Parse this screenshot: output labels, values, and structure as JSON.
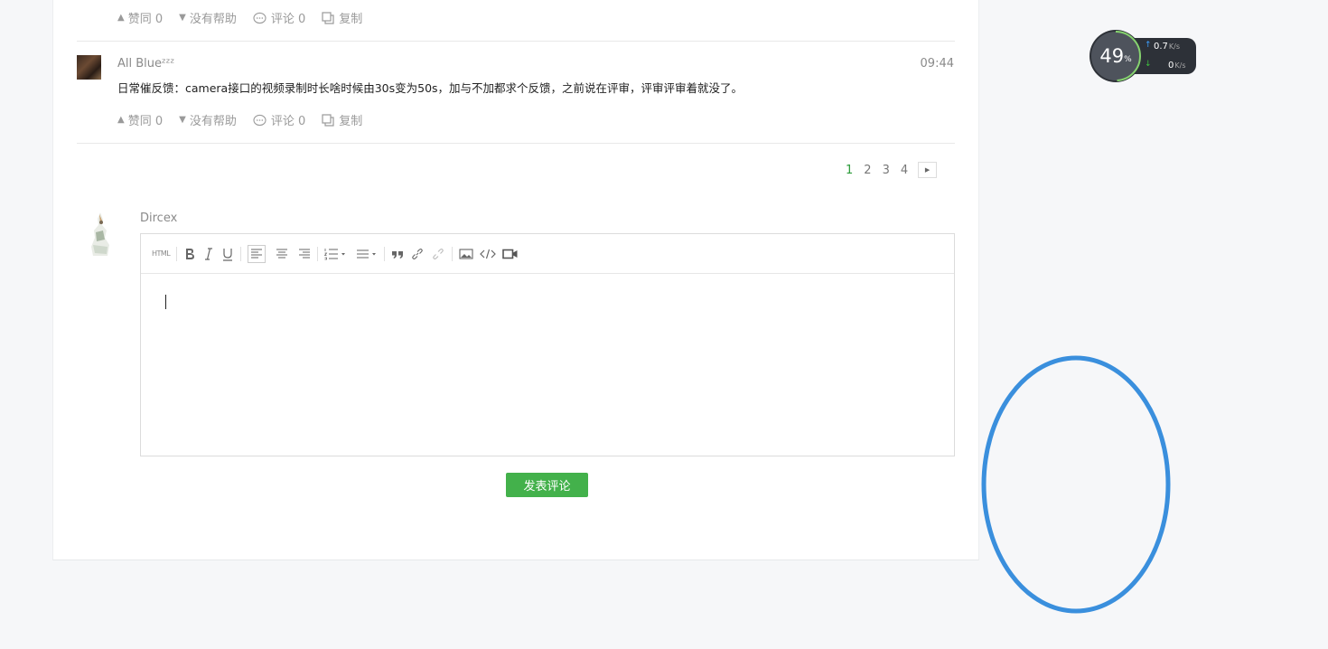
{
  "actions_labels": {
    "agree": "赞同 0",
    "unhelpful": "没有帮助",
    "comment": "评论 0",
    "copy": "复制"
  },
  "answer": {
    "author": "All Blueᶻᶻᶻ",
    "time": "09:44",
    "content": "日常催反馈：camera接口的视频录制时长啥时候由30s变为50s，加与不加都求个反馈，之前说在评审，评审评审着就没了。"
  },
  "pagination": {
    "pages": [
      "1",
      "2",
      "3",
      "4"
    ],
    "active": "1",
    "next_icon": "caret-right-icon"
  },
  "reply": {
    "username": "Dircex",
    "submit_label": "发表评论",
    "toolbar_html_label": "HTML"
  },
  "net_widget": {
    "percent": "49",
    "percent_sign": "%",
    "up": "0.7",
    "down": "0",
    "unit": "K/s",
    "up_color": "#3ca0ff",
    "down_color": "#3ec23e"
  },
  "colors": {
    "accent_green": "#43b14b",
    "annotation_blue": "#3a8fdd"
  }
}
